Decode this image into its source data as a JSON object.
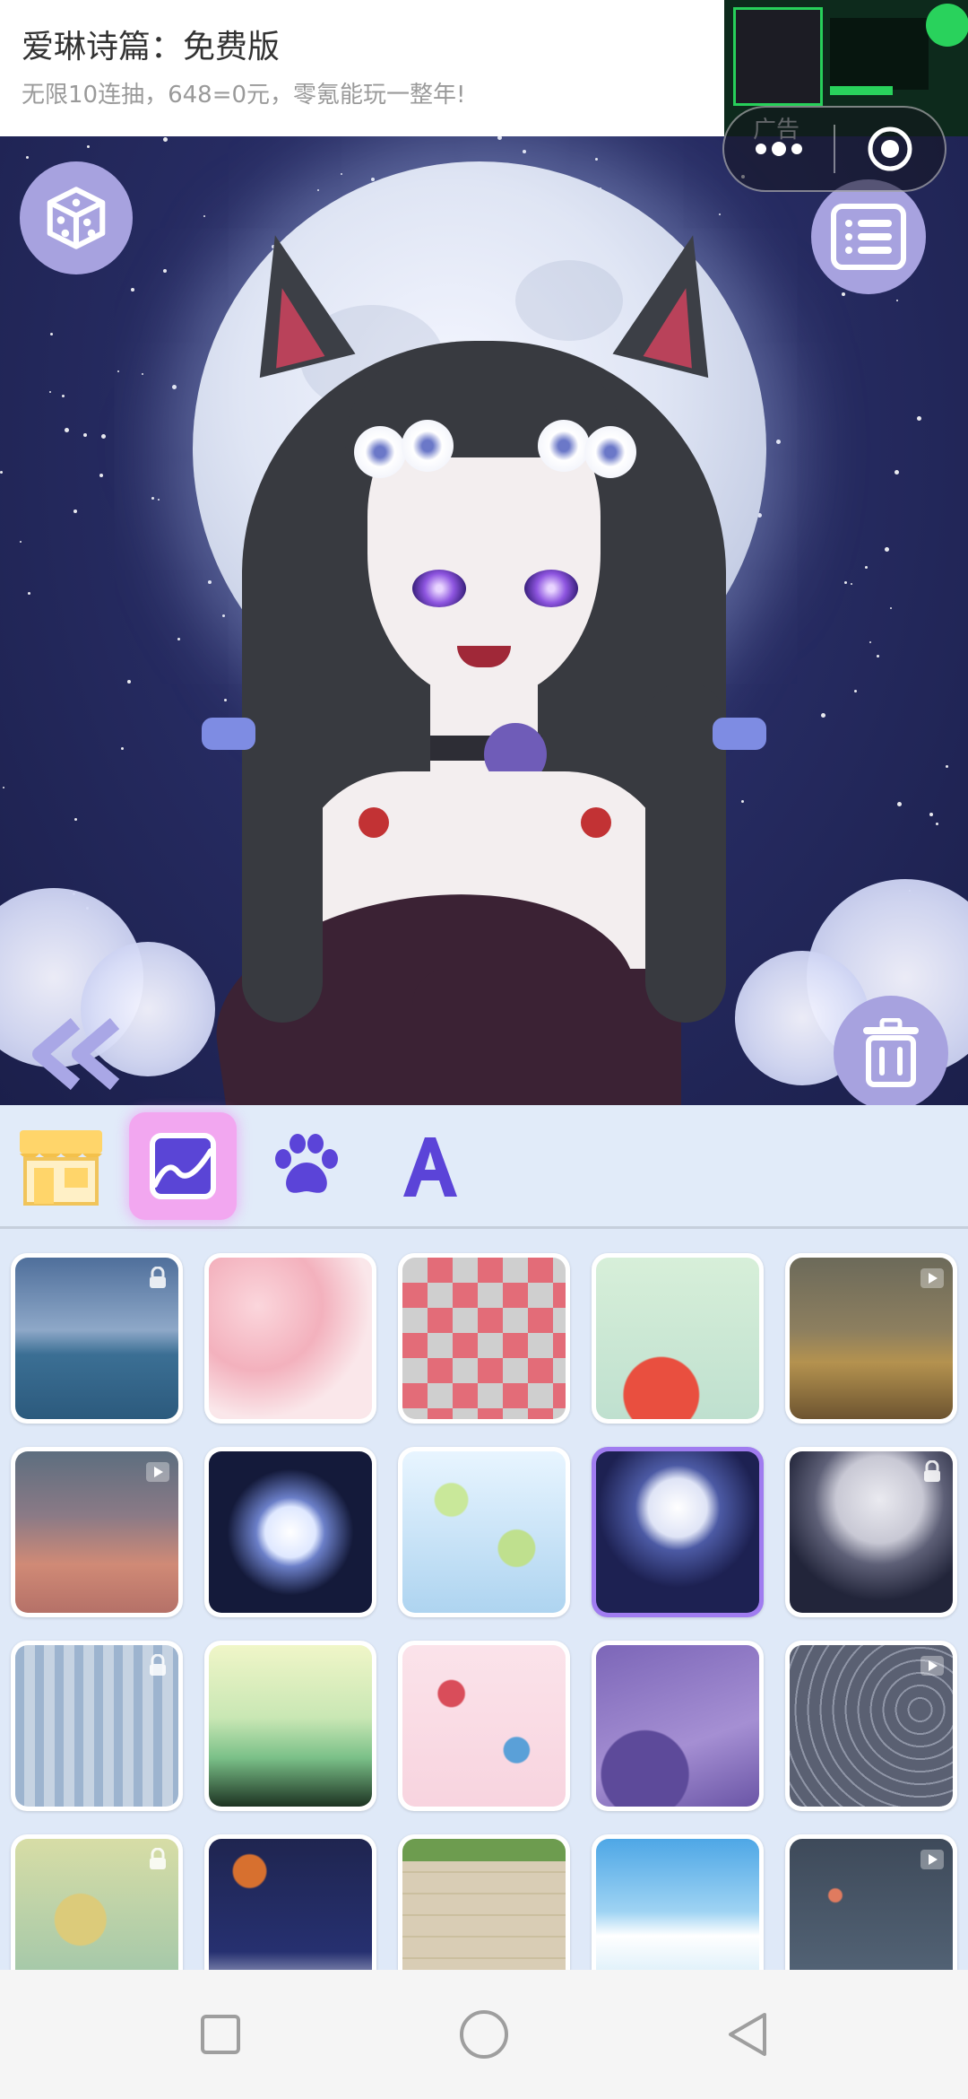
{
  "ad": {
    "title": "爱琳诗篇：免费版",
    "description": "无限10连抽，648=0元，零氪能玩一整年!",
    "label": "广告"
  },
  "toolbar": {
    "tabs": [
      {
        "name": "shop",
        "icon": "storefront-icon",
        "selected": false
      },
      {
        "name": "background",
        "icon": "landscape-image-icon",
        "selected": true
      },
      {
        "name": "pet",
        "icon": "paw-icon",
        "selected": false
      },
      {
        "name": "text",
        "icon": "letter-a-icon",
        "selected": false
      }
    ]
  },
  "scene_controls": {
    "randomize": "dice-icon",
    "menu": "list-menu-icon",
    "back": "double-chevron-left-icon",
    "delete": "trash-icon"
  },
  "backgrounds": [
    {
      "theme": "cloudy sea",
      "status": "locked"
    },
    {
      "theme": "cherry blossom",
      "status": "free"
    },
    {
      "theme": "checkered",
      "status": "free"
    },
    {
      "theme": "watermelon",
      "status": "free"
    },
    {
      "theme": "desert dunes",
      "status": "video"
    },
    {
      "theme": "dusk sky",
      "status": "video"
    },
    {
      "theme": "full moon",
      "status": "free"
    },
    {
      "theme": "lily pond",
      "status": "free"
    },
    {
      "theme": "moon with flowers",
      "status": "selected"
    },
    {
      "theme": "starry moon",
      "status": "locked"
    },
    {
      "theme": "misty forest",
      "status": "locked"
    },
    {
      "theme": "green mountains",
      "status": "free"
    },
    {
      "theme": "dice pattern",
      "status": "free"
    },
    {
      "theme": "purple clouds",
      "status": "free"
    },
    {
      "theme": "spider web",
      "status": "video"
    },
    {
      "theme": "golden waves",
      "status": "locked"
    },
    {
      "theme": "night waves",
      "status": "free"
    },
    {
      "theme": "stone wall",
      "status": "free"
    },
    {
      "theme": "blue sky",
      "status": "free"
    },
    {
      "theme": "night crescent",
      "status": "video"
    }
  ],
  "colors": {
    "accent": "#a07cf0",
    "tab_highlight": "#f2a7f0",
    "button": "#a7a2df",
    "panel": "#dfe9f8"
  }
}
